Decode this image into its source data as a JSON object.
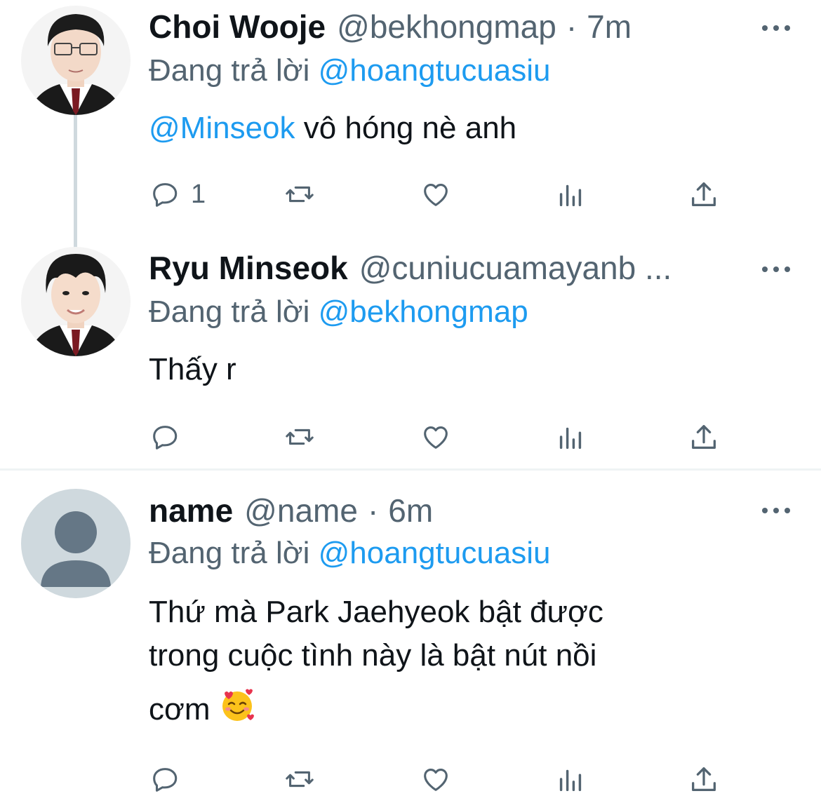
{
  "tweets": [
    {
      "name": "Choi Wooje",
      "handle": "@bekhongmap",
      "time": "7m",
      "replying_prefix": "Đang trả lời",
      "replying_to": "@hoangtucuasiu",
      "mention": "@Minseok",
      "text": "vô hóng nè anh",
      "reply_count": "1"
    },
    {
      "name": "Ryu Minseok",
      "handle": "@cuniucuamayanb ...",
      "replying_prefix": "Đang trả lời",
      "replying_to": "@bekhongmap",
      "text": "Thấy r",
      "reply_count": ""
    },
    {
      "name": "name",
      "handle": "@name",
      "time": "6m",
      "replying_prefix": "Đang trả lời",
      "replying_to": "@hoangtucuasiu",
      "text_line1": "Thứ mà Park Jaehyeok bật được",
      "text_line2": "trong cuộc tình này là bật nút nồi",
      "text_line3": "cơm",
      "emoji": "smiling-face-with-hearts",
      "reply_count": ""
    }
  ],
  "colors": {
    "accent": "#1d9bf0",
    "secondary": "#536471",
    "text": "#0f1419"
  }
}
